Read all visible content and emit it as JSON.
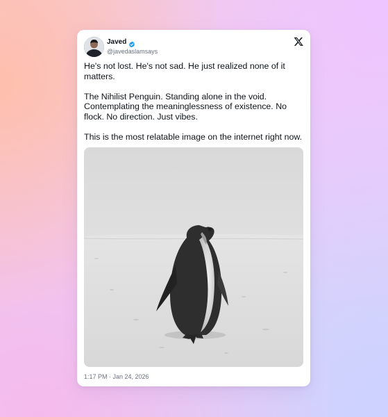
{
  "author": {
    "name": "Javed",
    "handle": "@javedaslamsays",
    "verified": true
  },
  "tweet": {
    "paragraphs": [
      "He's not lost. He's not sad. He just realized none of it matters.",
      "The Nihilist Penguin. Standing alone in the void. Contemplating the meaninglessness of existence. No flock. No direction. Just vibes.",
      "This is the most relatable image on the internet right now."
    ],
    "timestamp": "1:17 PM · Jan 24, 2026"
  },
  "icons": {
    "verified_badge": "verified-badge-icon",
    "platform": "x-logo-icon"
  },
  "colors": {
    "text_primary": "#0f1419",
    "text_secondary": "#6b7280",
    "verified_blue": "#1d9bf0",
    "card": "#ffffff"
  }
}
